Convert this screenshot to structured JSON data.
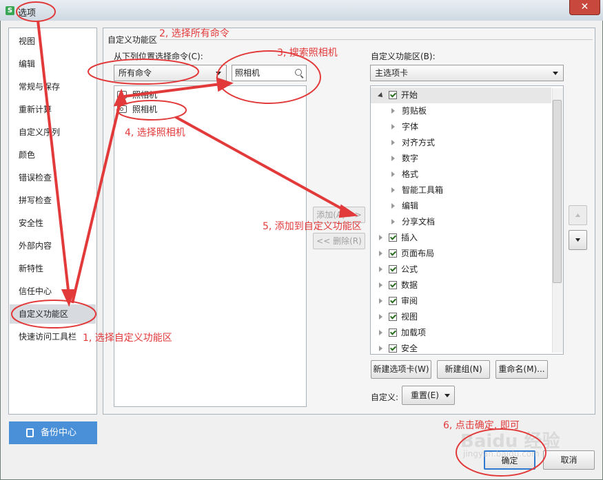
{
  "window": {
    "title": "选项",
    "app_icon_glyph": "S",
    "close_glyph": "✕"
  },
  "nav": {
    "items": [
      "视图",
      "编辑",
      "常规与保存",
      "重新计算",
      "自定义序列",
      "颜色",
      "错误检查",
      "拼写检查",
      "安全性",
      "外部内容",
      "新特性",
      "信任中心",
      "自定义功能区",
      "快速访问工具栏"
    ],
    "selected": "自定义功能区"
  },
  "backup": {
    "label": "备份中心"
  },
  "section_title": "自定义功能区",
  "left_panel": {
    "choose_label": "从下列位置选择命令(C):",
    "choose_value": "所有命令",
    "search_value": "照相机",
    "commands": [
      "照相机",
      "照相机"
    ]
  },
  "middle": {
    "add_label": "添加(A) >>",
    "remove_label": "<< 删除(R)"
  },
  "right_panel": {
    "label": "自定义功能区(B):",
    "dropdown_value": "主选项卡",
    "tree": [
      {
        "label": "开始",
        "level": 0,
        "expanded": true,
        "checked": true
      },
      {
        "label": "剪贴板",
        "level": 1
      },
      {
        "label": "字体",
        "level": 1
      },
      {
        "label": "对齐方式",
        "level": 1
      },
      {
        "label": "数字",
        "level": 1
      },
      {
        "label": "格式",
        "level": 1
      },
      {
        "label": "智能工具箱",
        "level": 1
      },
      {
        "label": "编辑",
        "level": 1
      },
      {
        "label": "分享文档",
        "level": 1
      },
      {
        "label": "插入",
        "level": 0,
        "checked": true
      },
      {
        "label": "页面布局",
        "level": 0,
        "checked": true
      },
      {
        "label": "公式",
        "level": 0,
        "checked": true
      },
      {
        "label": "数据",
        "level": 0,
        "checked": true
      },
      {
        "label": "审阅",
        "level": 0,
        "checked": true
      },
      {
        "label": "视图",
        "level": 0,
        "checked": true
      },
      {
        "label": "加载项",
        "level": 0,
        "checked": true
      },
      {
        "label": "安全",
        "level": 0,
        "checked": true
      }
    ],
    "buttons": {
      "new_tab": "新建选项卡(W)",
      "new_group": "新建组(N)",
      "rename": "重命名(M)..."
    },
    "customize_label": "自定义:",
    "reset_label": "重置(E)"
  },
  "footer": {
    "ok": "确定",
    "cancel": "取消"
  },
  "annotations": {
    "step1": "1, 选择自定义功能区",
    "step2": "2, 选择所有命令",
    "step3": "3, 搜索照相机",
    "step4": "4, 选择照相机",
    "step5": "5, 添加到自定义功能区",
    "step6": "6, 点击确定, 即可"
  },
  "watermark": {
    "brand": "Baidu 经验",
    "url": "jingyan.baidu.com"
  },
  "colors": {
    "annotation": "#e23a3a",
    "accent": "#4a90d9",
    "selected_nav": "#d7dbe0"
  }
}
